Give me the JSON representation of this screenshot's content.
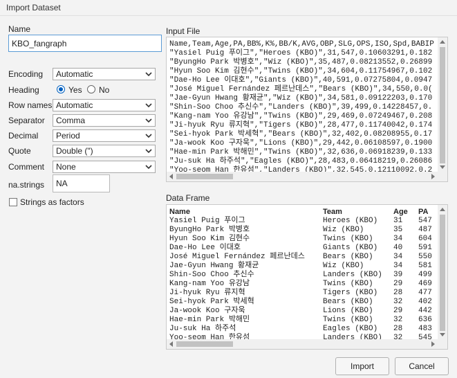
{
  "window": {
    "title": "Import Dataset"
  },
  "form": {
    "name_label": "Name",
    "name_value": "KBO_fangraph",
    "encoding_label": "Encoding",
    "encoding_value": "Automatic",
    "heading_label": "Heading",
    "heading_yes": "Yes",
    "heading_no": "No",
    "heading_selected": "Yes",
    "row_names_label": "Row names",
    "row_names_value": "Automatic",
    "separator_label": "Separator",
    "separator_value": "Comma",
    "decimal_label": "Decimal",
    "decimal_value": "Period",
    "quote_label": "Quote",
    "quote_value": "Double (\")",
    "comment_label": "Comment",
    "comment_value": "None",
    "na_label": "na.strings",
    "na_value": "NA",
    "strings_factors_label": "Strings as factors",
    "strings_factors_checked": false
  },
  "input_file": {
    "label": "Input File",
    "lines": [
      "Name,Team,Age,PA,BB%,K%,BB/K,AVG,OBP,SLG,OPS,ISO,Spd,BABIP",
      "\"Yasiel Puig 푸이그\",\"Heroes (KBO)\",31,547,0.10603291,0.182",
      "\"ByungHo Park 박병호\",\"Wiz (KBO)\",35,487,0.08213552,0.26899",
      "\"Hyun Soo Kim 김현수\",\"Twins (KBO)\",34,604,0.11754967,0.102",
      "\"Dae-Ho Lee 이대호\",\"Giants (KBO)\",40,591,0.07275804,0.0947",
      "\"José Miguel Fernández 페르난데스\",\"Bears (KBO)\",34,550,0.0(",
      "\"Jae-Gyun Hwang 황재균\",\"Wiz (KBO)\",34,581,0.09122203,0.170",
      "\"Shin-Soo Choo 추신수\",\"Landers (KBO)\",39,499,0.14228457,0.",
      "\"Kang-nam Yoo 유강남\",\"Twins (KBO)\",29,469,0.07249467,0.208",
      "\"Ji-hyuk Ryu 류지혁\",\"Tigers (KBO)\",28,477,0.11740042,0.174",
      "\"Sei-hyok Park 박세혁\",\"Bears (KBO)\",32,402,0.08208955,0.17",
      "\"Ja-wook Koo 구자욱\",\"Lions (KBO)\",29,442,0.06108597,0.1900",
      "\"Hae-min Park 박해민\",\"Twins (KBO)\",32,636,0.06918239,0.133",
      "\"Ju-suk Ha 하주석\",\"Eagles (KBO)\",28,483,0.06418219,0.26086",
      "\"Yoo-seom Han 한유섬\",\"Landers (KBO)\",32,545,0.12110092,0.2"
    ]
  },
  "data_frame": {
    "label": "Data Frame",
    "columns": [
      "Name",
      "Team",
      "Age",
      "PA"
    ],
    "rows": [
      [
        "Yasiel Puig 푸이그",
        "Heroes (KBO)",
        "31",
        "547"
      ],
      [
        "ByungHo Park 박병호",
        "Wiz (KBO)",
        "35",
        "487"
      ],
      [
        "Hyun Soo Kim 김현수",
        "Twins (KBO)",
        "34",
        "604"
      ],
      [
        "Dae-Ho Lee 이대호",
        "Giants (KBO)",
        "40",
        "591"
      ],
      [
        "José Miguel Fernández 페르난데스",
        "Bears (KBO)",
        "34",
        "550"
      ],
      [
        "Jae-Gyun Hwang 황재균",
        "Wiz (KBO)",
        "34",
        "581"
      ],
      [
        "Shin-Soo Choo 추신수",
        "Landers (KBO)",
        "39",
        "499"
      ],
      [
        "Kang-nam Yoo 유강남",
        "Twins (KBO)",
        "29",
        "469"
      ],
      [
        "Ji-hyuk Ryu 류지혁",
        "Tigers (KBO)",
        "28",
        "477"
      ],
      [
        "Sei-hyok Park 박세혁",
        "Bears (KBO)",
        "32",
        "402"
      ],
      [
        "Ja-wook Koo 구자욱",
        "Lions (KBO)",
        "29",
        "442"
      ],
      [
        "Hae-min Park 박해민",
        "Twins (KBO)",
        "32",
        "636"
      ],
      [
        "Ju-suk Ha 하주석",
        "Eagles (KBO)",
        "28",
        "483"
      ],
      [
        "Yoo-seom Han 한유섬",
        "Landers (KBO)",
        "32",
        "545"
      ]
    ]
  },
  "buttons": {
    "import": "Import",
    "cancel": "Cancel"
  },
  "colors": {
    "focus_border": "#5b9bd5",
    "radio_selected": "#0060c0"
  }
}
